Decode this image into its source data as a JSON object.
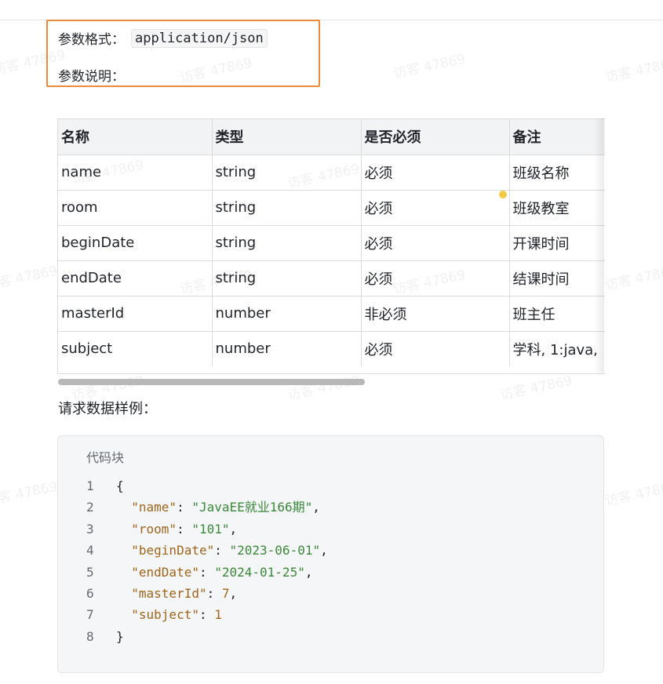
{
  "params": {
    "format_label": "参数格式：",
    "format_value": "application/json",
    "desc_label": "参数说明："
  },
  "table": {
    "headers": [
      "名称",
      "类型",
      "是否必须",
      "备注"
    ],
    "rows": [
      [
        "name",
        "string",
        "必须",
        "班级名称"
      ],
      [
        "room",
        "string",
        "必须",
        "班级教室"
      ],
      [
        "beginDate",
        "string",
        "必须",
        "开课时间"
      ],
      [
        "endDate",
        "string",
        "必须",
        "结课时间"
      ],
      [
        "masterId",
        "number",
        "非必须",
        "班主任"
      ],
      [
        "subject",
        "number",
        "必须",
        "学科, 1:java,"
      ]
    ]
  },
  "example_label": "请求数据样例：",
  "code": {
    "title": "代码块",
    "line_numbers": [
      "1",
      "2",
      "3",
      "4",
      "5",
      "6",
      "7",
      "8"
    ],
    "lines": [
      {
        "parts": [
          {
            "t": "{",
            "c": "p"
          }
        ]
      },
      {
        "parts": [
          {
            "t": "  ",
            "c": "p"
          },
          {
            "t": "\"name\"",
            "c": "k"
          },
          {
            "t": ": ",
            "c": "p"
          },
          {
            "t": "\"JavaEE就业166期\"",
            "c": "s"
          },
          {
            "t": ",",
            "c": "p"
          }
        ]
      },
      {
        "parts": [
          {
            "t": "  ",
            "c": "p"
          },
          {
            "t": "\"room\"",
            "c": "k"
          },
          {
            "t": ": ",
            "c": "p"
          },
          {
            "t": "\"101\"",
            "c": "s"
          },
          {
            "t": ",",
            "c": "p"
          }
        ]
      },
      {
        "parts": [
          {
            "t": "  ",
            "c": "p"
          },
          {
            "t": "\"beginDate\"",
            "c": "k"
          },
          {
            "t": ": ",
            "c": "p"
          },
          {
            "t": "\"2023-06-01\"",
            "c": "s"
          },
          {
            "t": ",",
            "c": "p"
          }
        ]
      },
      {
        "parts": [
          {
            "t": "  ",
            "c": "p"
          },
          {
            "t": "\"endDate\"",
            "c": "k"
          },
          {
            "t": ": ",
            "c": "p"
          },
          {
            "t": "\"2024-01-25\"",
            "c": "s"
          },
          {
            "t": ",",
            "c": "p"
          }
        ]
      },
      {
        "parts": [
          {
            "t": "  ",
            "c": "p"
          },
          {
            "t": "\"masterId\"",
            "c": "k"
          },
          {
            "t": ": ",
            "c": "p"
          },
          {
            "t": "7",
            "c": "n"
          },
          {
            "t": ",",
            "c": "p"
          }
        ]
      },
      {
        "parts": [
          {
            "t": "  ",
            "c": "p"
          },
          {
            "t": "\"subject\"",
            "c": "k"
          },
          {
            "t": ": ",
            "c": "p"
          },
          {
            "t": "1",
            "c": "n"
          }
        ]
      },
      {
        "parts": [
          {
            "t": "}",
            "c": "p"
          }
        ]
      }
    ]
  },
  "watermark": "访客 47869",
  "colors": {
    "highlight_border": "#f08a3c",
    "json_key": "#a0641a",
    "json_string": "#3a8a3a",
    "code_bg": "#f5f6f7"
  }
}
